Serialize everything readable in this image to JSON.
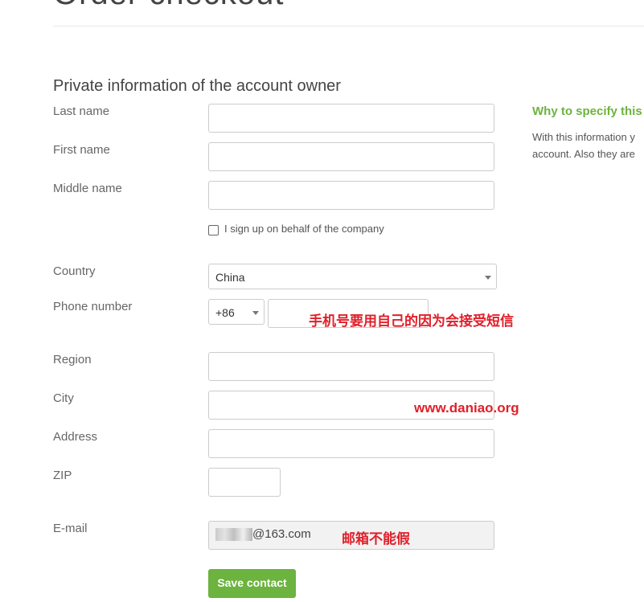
{
  "page": {
    "title": "Order checkout"
  },
  "section": {
    "title": "Private information of the account owner"
  },
  "fields": {
    "last_name": "Last name",
    "first_name": "First name",
    "middle_name": "Middle name",
    "company_checkbox": "I sign up on behalf of the company",
    "country": "Country",
    "country_value": "China",
    "phone": "Phone number",
    "phone_code": "+86",
    "region": "Region",
    "city": "City",
    "address": "Address",
    "zip": "ZIP",
    "email": "E-mail",
    "email_value": "@163.com"
  },
  "annotations": {
    "phone": "手机号要用自己的因为会接受短信",
    "site": "www.daniao.org",
    "email": "邮箱不能假"
  },
  "sidebar": {
    "heading": "Why to specify this",
    "text1": "With this information y",
    "text2": "account. Also they are"
  },
  "actions": {
    "save": "Save contact"
  },
  "colors": {
    "accent": "#6cb33f",
    "annotation": "#e0202a"
  }
}
